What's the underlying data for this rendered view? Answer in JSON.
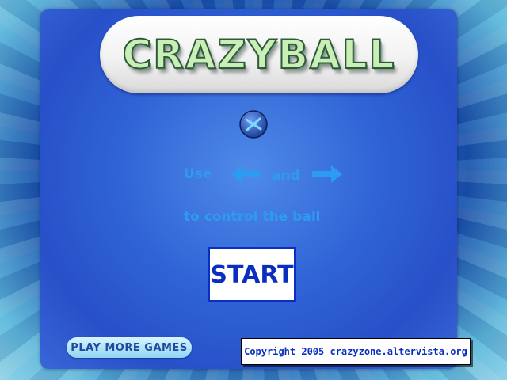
{
  "game": {
    "title": "CRAZYBALL",
    "instructions": {
      "use": "Use",
      "and": "and",
      "to_control": "to control the ball"
    },
    "left_arrow_icon": "left-arrow-icon",
    "right_arrow_icon": "right-arrow-icon",
    "ball_icon": "ball-icon",
    "start_label": "START",
    "play_more_label": "PLAY MORE GAMES",
    "copyright": "Copyright 2005 crazyzone.altervista.org",
    "colors": {
      "instruction_text": "#2d9bf2",
      "start_border": "#0a2ec0",
      "panel": "#2f63d6",
      "title_fill": "#c9efb6"
    }
  }
}
